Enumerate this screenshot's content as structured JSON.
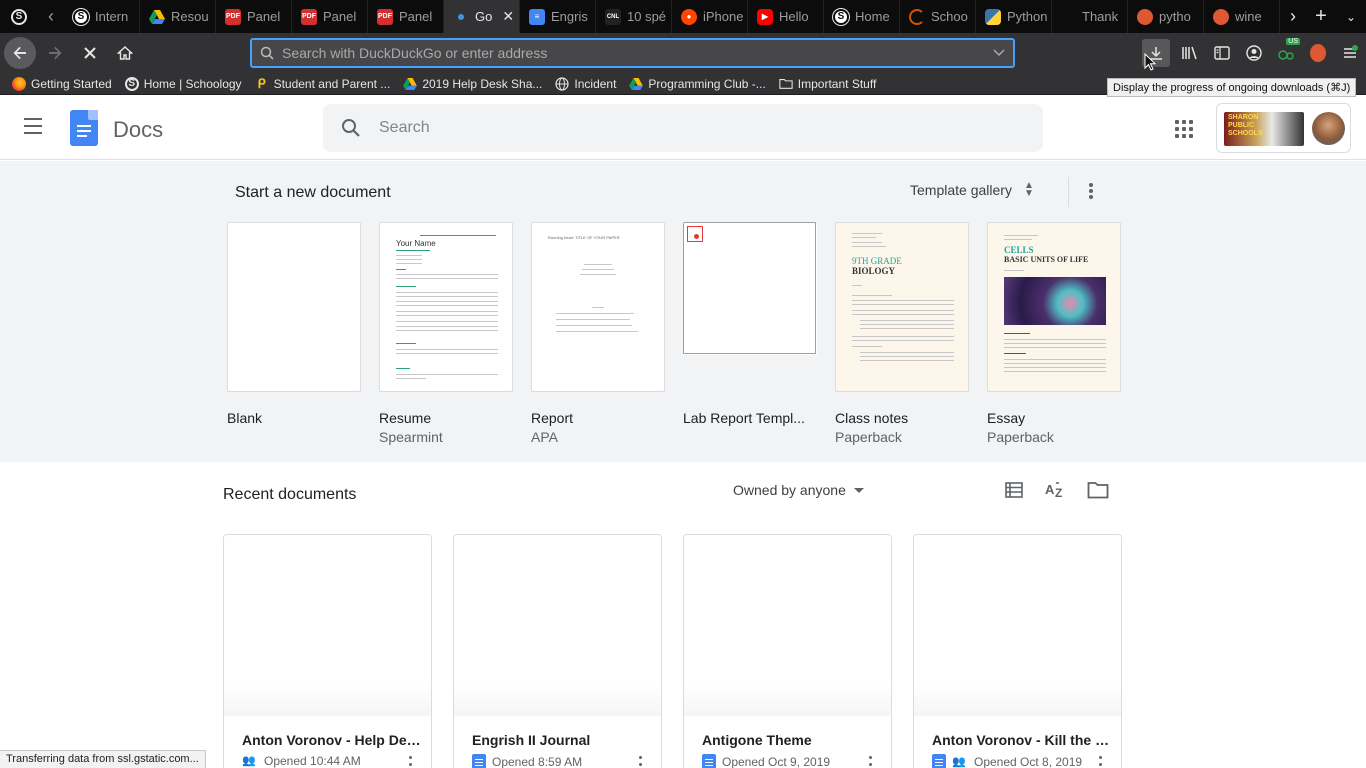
{
  "browser": {
    "tabs": [
      {
        "label": "Intern",
        "favicon": "schoology-icon"
      },
      {
        "label": "Resou",
        "favicon": "drive-icon"
      },
      {
        "label": "Panel",
        "favicon": "pdf-icon"
      },
      {
        "label": "Panel",
        "favicon": "pdf-icon"
      },
      {
        "label": "Panel",
        "favicon": "pdf-icon"
      },
      {
        "label": "Go",
        "favicon": "loading-icon",
        "active": true
      },
      {
        "label": "Engris",
        "favicon": "docs-icon"
      },
      {
        "label": "10 spé",
        "favicon": "cnl-icon"
      },
      {
        "label": "iPhone",
        "favicon": "reddit-icon"
      },
      {
        "label": "Hello",
        "favicon": "youtube-icon"
      },
      {
        "label": "Home",
        "favicon": "schoology-icon"
      },
      {
        "label": "Schoo",
        "favicon": "schoology-icon"
      },
      {
        "label": "Python",
        "favicon": "python-icon"
      },
      {
        "label": "Thank",
        "favicon": "none"
      },
      {
        "label": "pytho",
        "favicon": "duckduckgo-icon"
      },
      {
        "label": "wine",
        "favicon": "duckduckgo-icon"
      }
    ],
    "favicon_text": {
      "pdf": "PDF",
      "schoology": "S",
      "cnl": "CNL"
    },
    "address_placeholder": "Search with DuckDuckGo or enter address",
    "extension_badge": "US",
    "bookmarks": [
      {
        "label": "Getting Started",
        "icon": "firefox-icon"
      },
      {
        "label": "Home | Schoology",
        "icon": "schoology-icon"
      },
      {
        "label": "Student and Parent ...",
        "icon": "pearson-icon"
      },
      {
        "label": "2019 Help Desk Sha...",
        "icon": "drive-icon"
      },
      {
        "label": "Incident",
        "icon": "globe-icon"
      },
      {
        "label": "Programming Club -...",
        "icon": "drive-icon"
      },
      {
        "label": "Important Stuff",
        "icon": "folder-icon"
      }
    ],
    "tooltip": "Display the progress of ongoing downloads (⌘J)",
    "status_text": "Transferring data from ssl.gstatic.com..."
  },
  "docs": {
    "app_name": "Docs",
    "search_placeholder": "Search",
    "org_logo_text": "SHARON PUBLIC SCHOOLS",
    "templates": {
      "section_title": "Start a new document",
      "gallery_label": "Template gallery",
      "items": [
        {
          "name": "Blank",
          "sub": ""
        },
        {
          "name": "Resume",
          "sub": "Spearmint"
        },
        {
          "name": "Report",
          "sub": "APA"
        },
        {
          "name": "Lab Report Templ...",
          "sub": ""
        },
        {
          "name": "Class notes",
          "sub": "Paperback"
        },
        {
          "name": "Essay",
          "sub": "Paperback"
        }
      ],
      "thumb_text": {
        "resume_name": "Your Name",
        "report_header": "Running head: TITLE OF YOUR PAPER",
        "classnotes_grade": "9TH GRADE",
        "classnotes_subject": "BIOLOGY",
        "essay_title1": "CELLS",
        "essay_title2": "BASIC UNITS OF LIFE"
      }
    },
    "recent": {
      "section_title": "Recent documents",
      "owner_filter": "Owned by anyone",
      "docs": [
        {
          "title": "Anton Voronov - Help Des...",
          "opened": "Opened 10:44 AM",
          "shared": true
        },
        {
          "title": "Engrish II Journal",
          "opened": "Opened 8:59 AM",
          "shared": false
        },
        {
          "title": "Antigone Theme",
          "opened": "Opened Oct 9, 2019",
          "shared": false
        },
        {
          "title": "Anton Voronov - Kill the K...",
          "opened": "Opened Oct 8, 2019",
          "shared": true
        }
      ]
    }
  }
}
